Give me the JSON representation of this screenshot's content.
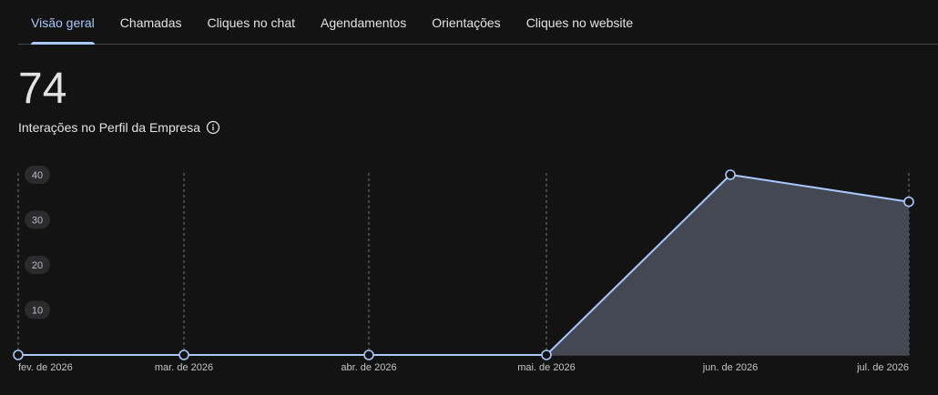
{
  "tabs": [
    {
      "label": "Visão geral",
      "active": true
    },
    {
      "label": "Chamadas",
      "active": false
    },
    {
      "label": "Cliques no chat",
      "active": false
    },
    {
      "label": "Agendamentos",
      "active": false
    },
    {
      "label": "Orientações",
      "active": false
    },
    {
      "label": "Cliques no website",
      "active": false
    }
  ],
  "summary": {
    "value": "74",
    "label": "Interações no Perfil da Empresa",
    "info_icon": "info-icon"
  },
  "colors": {
    "accent": "#a8c7fa",
    "area_fill": "#474b55",
    "background": "#131314"
  },
  "chart_data": {
    "type": "area",
    "categories": [
      "fev. de 2026",
      "mar. de 2026",
      "abr. de 2026",
      "mai. de 2026",
      "jun. de 2026",
      "jul. de 2026"
    ],
    "values": [
      0,
      0,
      0,
      0,
      40,
      34
    ],
    "ylim": [
      0,
      40
    ],
    "yticks": [
      "10",
      "20",
      "30",
      "40"
    ],
    "grid": "vertical dashed lines at each month",
    "title": "",
    "xlabel": "",
    "ylabel": ""
  }
}
